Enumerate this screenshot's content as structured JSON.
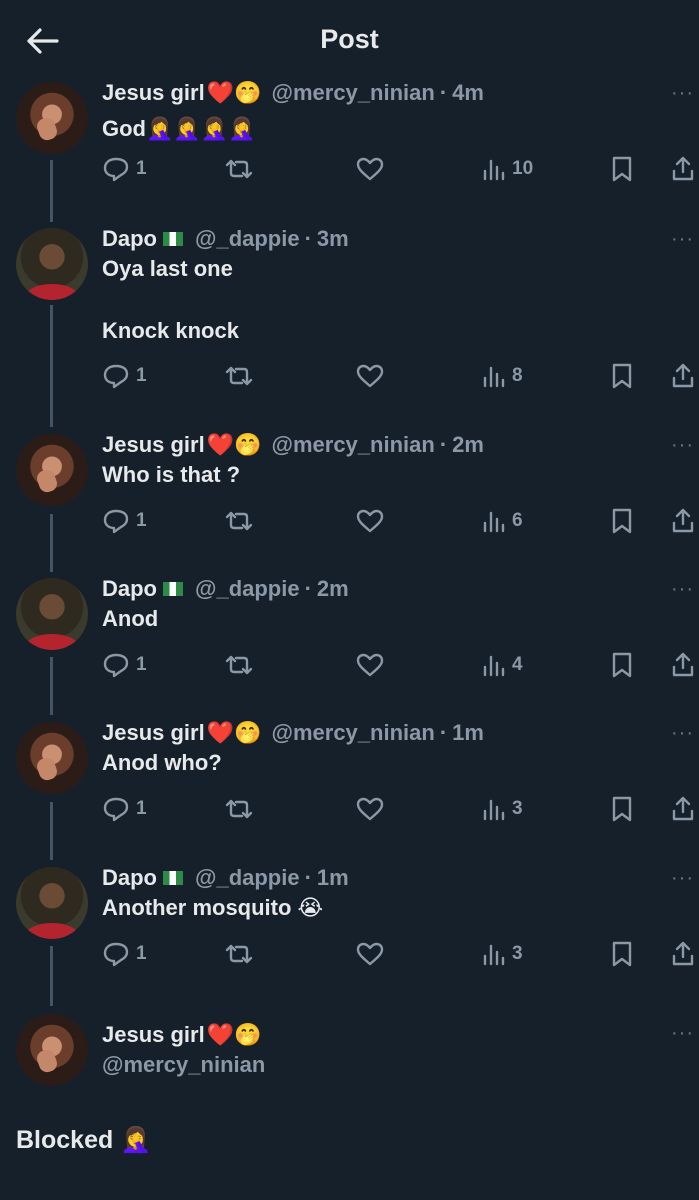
{
  "header": {
    "title": "Post",
    "back_icon": "arrow-left-icon"
  },
  "colors": {
    "background": "#15202b",
    "text": "#e7e9ea",
    "muted": "#8b98a5",
    "thread_line": "#425466"
  },
  "tweets": [
    {
      "display_name": "Jesus girl",
      "name_emojis": "❤️🤭",
      "flag": false,
      "handle": "@mercy_ninian",
      "separator": "·",
      "time": "4m",
      "text_lines": [
        "God🤦‍♀️🤦‍♀️🤦‍♀️🤦‍♀️"
      ],
      "replies": "1",
      "views": "10"
    },
    {
      "display_name": "Dapo",
      "name_emojis": "",
      "flag": true,
      "handle": "@_dappie",
      "separator": "·",
      "time": "3m",
      "text_lines": [
        "Oya last one",
        "Knock knock"
      ],
      "replies": "1",
      "views": "8"
    },
    {
      "display_name": "Jesus girl",
      "name_emojis": "❤️🤭",
      "flag": false,
      "handle": "@mercy_ninian",
      "separator": "·",
      "time": "2m",
      "text_lines": [
        "Who is that ?"
      ],
      "replies": "1",
      "views": "6"
    },
    {
      "display_name": "Dapo",
      "name_emojis": "",
      "flag": true,
      "handle": "@_dappie",
      "separator": "·",
      "time": "2m",
      "text_lines": [
        "Anod"
      ],
      "replies": "1",
      "views": "4"
    },
    {
      "display_name": "Jesus girl",
      "name_emojis": "❤️🤭",
      "flag": false,
      "handle": "@mercy_ninian",
      "separator": "·",
      "time": "1m",
      "text_lines": [
        "Anod who?"
      ],
      "replies": "1",
      "views": "3"
    },
    {
      "display_name": "Dapo",
      "name_emojis": "",
      "flag": true,
      "handle": "@_dappie",
      "separator": "·",
      "time": "1m",
      "text_lines": [
        "Another mosquito 😭"
      ],
      "replies": "1",
      "views": "3"
    }
  ],
  "main_post": {
    "display_name": "Jesus girl",
    "name_emojis": "❤️🤭",
    "handle": "@mercy_ninian",
    "text": "Blocked 🤦‍♀️"
  },
  "icons": [
    "reply-icon",
    "retweet-icon",
    "like-icon",
    "views-icon",
    "bookmark-icon",
    "share-icon",
    "more-icon"
  ]
}
